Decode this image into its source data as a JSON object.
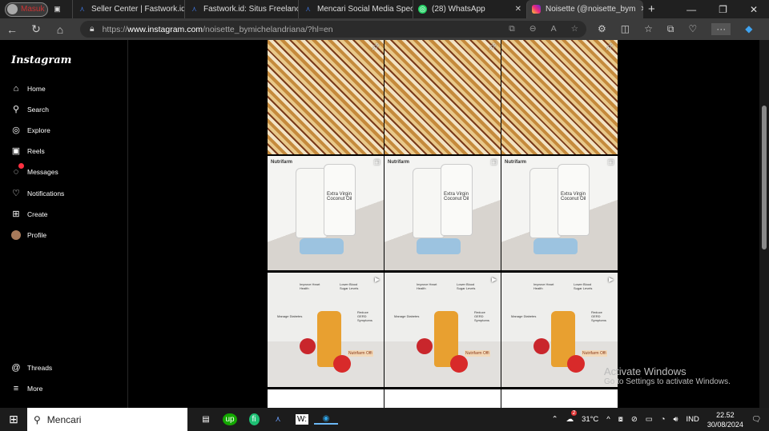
{
  "browser": {
    "profile_label": "Masuk",
    "tabs": [
      {
        "title": "Seller Center | Fastwork.id",
        "icon": "fastwork-icon"
      },
      {
        "title": "Fastwork.id: Situs Freelance",
        "icon": "fastwork-icon"
      },
      {
        "title": "Mencari Social Media Spec",
        "icon": "fastwork-icon"
      },
      {
        "title": "(28) WhatsApp",
        "icon": "whatsapp-icon"
      },
      {
        "title": "Noisette (@noisette_bym",
        "icon": "instagram-icon"
      }
    ],
    "url_prefix": "https://",
    "url_host": "www.instagram.com",
    "url_path": "/noisette_bymichelandriana/?hl=en"
  },
  "sidebar": {
    "logo": "Instagram",
    "items": [
      {
        "label": "Home"
      },
      {
        "label": "Search"
      },
      {
        "label": "Explore"
      },
      {
        "label": "Reels"
      },
      {
        "label": "Messages"
      },
      {
        "label": "Notifications"
      },
      {
        "label": "Create"
      },
      {
        "label": "Profile"
      }
    ],
    "bottom": [
      {
        "label": "Threads"
      },
      {
        "label": "More"
      }
    ]
  },
  "posts": {
    "brand": "Nutrifarm",
    "coconut_label": "Extra Virgin Coconut Oil",
    "acv_callouts": [
      "Improve Heart Health",
      "Lower Blood Sugar Levels",
      "Manage Diabetes",
      "Reduce GERD Symptoms"
    ],
    "acv_sign": "Nutrifarm Offi"
  },
  "watermark": {
    "title": "Activate Windows",
    "subtitle": "Go to Settings to activate Windows."
  },
  "taskbar": {
    "search_placeholder": "Mencari",
    "weather_badge": "2",
    "temperature": "31°C",
    "language": "IND",
    "time": "22.52",
    "date": "30/08/2024"
  }
}
